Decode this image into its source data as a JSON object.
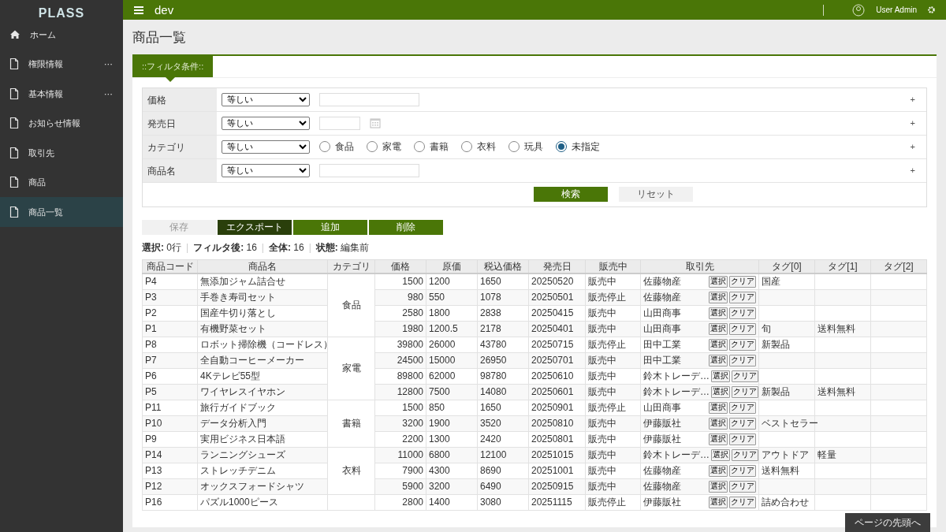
{
  "header": {
    "logo": "PLASS",
    "title": "dev",
    "user": "User Admin"
  },
  "sidebar": {
    "items": [
      {
        "label": "ホーム",
        "kind": "home",
        "selected": false
      },
      {
        "label": "権限情報",
        "kind": "page",
        "more": "⋯",
        "selected": false
      },
      {
        "label": "基本情報",
        "kind": "page",
        "more": "⋯",
        "selected": false
      },
      {
        "label": "お知らせ情報",
        "kind": "page",
        "selected": false
      },
      {
        "label": "取引先",
        "kind": "page",
        "selected": false
      },
      {
        "label": "商品",
        "kind": "page",
        "selected": false
      },
      {
        "label": "商品一覧",
        "kind": "page",
        "selected": true
      }
    ]
  },
  "page_title": "商品一覧",
  "filter": {
    "tab": "::フィルタ条件::",
    "rows": [
      {
        "label": "価格",
        "operator": "等しい",
        "kind": "text",
        "expand": "+"
      },
      {
        "label": "発売日",
        "operator": "等しい",
        "kind": "date",
        "expand": "+"
      },
      {
        "label": "カテゴリ",
        "operator": "等しい",
        "kind": "radio",
        "expand": "+",
        "options": [
          {
            "label": "食品",
            "selected": false
          },
          {
            "label": "家電",
            "selected": false
          },
          {
            "label": "書籍",
            "selected": false
          },
          {
            "label": "衣料",
            "selected": false
          },
          {
            "label": "玩具",
            "selected": false
          },
          {
            "label": "未指定",
            "selected": true
          }
        ]
      },
      {
        "label": "商品名",
        "operator": "等しい",
        "kind": "text",
        "expand": "+"
      }
    ],
    "buttons": [
      {
        "label": "検索",
        "kind": "primary"
      },
      {
        "label": "リセット",
        "kind": "light"
      }
    ]
  },
  "actions": [
    {
      "label": "保存",
      "kind": "light",
      "disabled": true
    },
    {
      "label": "エクスポート",
      "kind": "dark",
      "disabled": false
    },
    {
      "label": "追加",
      "kind": "primary",
      "disabled": false
    },
    {
      "label": "削除",
      "kind": "primary",
      "disabled": false
    }
  ],
  "status": [
    {
      "label": "選択:",
      "value": "0行"
    },
    {
      "separator": "|",
      "label": "フィルタ後:",
      "value": "16"
    },
    {
      "separator": "|",
      "label": "全体:",
      "value": "16"
    },
    {
      "separator": "|",
      "label": "状態:",
      "value": "編集前"
    }
  ],
  "table": {
    "columns": [
      "商品コード",
      "商品名",
      "カテゴリ",
      "価格",
      "原価",
      "税込価格",
      "発売日",
      "販売中",
      "取引先",
      "タグ[0]",
      "タグ[1]",
      "タグ[2]"
    ],
    "groups": [
      {
        "category": "食品",
        "rows": [
          {
            "code": "P4",
            "name": "無添加ジャム詰合せ",
            "price": "1500",
            "cost": "1200",
            "tax_price": "1650",
            "release": "20250520",
            "sale": "販売中",
            "supplier": "佐藤物産",
            "buttons": [
              "選択",
              "クリア"
            ],
            "tags": [
              "国産"
            ]
          },
          {
            "code": "P3",
            "name": "手巻き寿司セット",
            "price": "980",
            "cost": "550",
            "tax_price": "1078",
            "release": "20250501",
            "sale": "販売停止",
            "supplier": "佐藤物産",
            "buttons": [
              "選択",
              "クリア"
            ],
            "tags": []
          },
          {
            "code": "P2",
            "name": "国産牛切り落とし",
            "price": "2580",
            "cost": "1800",
            "tax_price": "2838",
            "release": "20250415",
            "sale": "販売中",
            "supplier": "山田商事",
            "buttons": [
              "選択",
              "クリア"
            ],
            "tags": []
          },
          {
            "code": "P1",
            "name": "有機野菜セット",
            "price": "1980",
            "cost": "1200.5",
            "tax_price": "2178",
            "release": "20250401",
            "sale": "販売中",
            "supplier": "山田商事",
            "buttons": [
              "選択",
              "クリア"
            ],
            "tags": [
              "旬",
              "送料無料"
            ]
          }
        ]
      },
      {
        "category": "家電",
        "rows": [
          {
            "code": "P8",
            "name": "ロボット掃除機（コードレス）",
            "price": "39800",
            "cost": "26000",
            "tax_price": "43780",
            "release": "20250715",
            "sale": "販売停止",
            "supplier": "田中工業",
            "buttons": [
              "選択",
              "クリア"
            ],
            "tags": [
              "新製品"
            ]
          },
          {
            "code": "P7",
            "name": "全自動コーヒーメーカー",
            "price": "24500",
            "cost": "15000",
            "tax_price": "26950",
            "release": "20250701",
            "sale": "販売中",
            "supplier": "田中工業",
            "buttons": [
              "選択",
              "クリア"
            ],
            "tags": []
          },
          {
            "code": "P6",
            "name": "4Kテレビ55型",
            "price": "89800",
            "cost": "62000",
            "tax_price": "98780",
            "release": "20250610",
            "sale": "販売中",
            "supplier": "鈴木トレーデ…",
            "buttons": [
              "選択",
              "クリア"
            ],
            "tags": []
          },
          {
            "code": "P5",
            "name": "ワイヤレスイヤホン",
            "price": "12800",
            "cost": "7500",
            "tax_price": "14080",
            "release": "20250601",
            "sale": "販売中",
            "supplier": "鈴木トレーデ…",
            "buttons": [
              "選択",
              "クリア"
            ],
            "tags": [
              "新製品",
              "送料無料"
            ]
          }
        ]
      },
      {
        "category": "書籍",
        "rows": [
          {
            "code": "P11",
            "name": "旅行ガイドブック",
            "price": "1500",
            "cost": "850",
            "tax_price": "1650",
            "release": "20250901",
            "sale": "販売停止",
            "supplier": "山田商事",
            "buttons": [
              "選択",
              "クリア"
            ],
            "tags": []
          },
          {
            "code": "P10",
            "name": "データ分析入門",
            "price": "3200",
            "cost": "1900",
            "tax_price": "3520",
            "release": "20250810",
            "sale": "販売中",
            "supplier": "伊藤販社",
            "buttons": [
              "選択",
              "クリア"
            ],
            "tags": [
              "ベストセラー"
            ]
          },
          {
            "code": "P9",
            "name": "実用ビジネス日本語",
            "price": "2200",
            "cost": "1300",
            "tax_price": "2420",
            "release": "20250801",
            "sale": "販売中",
            "supplier": "伊藤販社",
            "buttons": [
              "選択",
              "クリア"
            ],
            "tags": []
          }
        ]
      },
      {
        "category": "衣料",
        "rows": [
          {
            "code": "P14",
            "name": "ランニングシューズ",
            "price": "11000",
            "cost": "6800",
            "tax_price": "12100",
            "release": "20251015",
            "sale": "販売中",
            "supplier": "鈴木トレーデ…",
            "buttons": [
              "選択",
              "クリア"
            ],
            "tags": [
              "アウトドア",
              "軽量"
            ]
          },
          {
            "code": "P13",
            "name": "ストレッチデニム",
            "price": "7900",
            "cost": "4300",
            "tax_price": "8690",
            "release": "20251001",
            "sale": "販売中",
            "supplier": "佐藤物産",
            "buttons": [
              "選択",
              "クリア"
            ],
            "tags": [
              "送料無料"
            ]
          },
          {
            "code": "P12",
            "name": "オックスフォードシャツ",
            "price": "5900",
            "cost": "3200",
            "tax_price": "6490",
            "release": "20250915",
            "sale": "販売中",
            "supplier": "佐藤物産",
            "buttons": [
              "選択",
              "クリア"
            ],
            "tags": []
          }
        ]
      },
      {
        "rows": [
          {
            "code": "P16",
            "name": "パズル1000ピース",
            "price": "2800",
            "cost": "1400",
            "tax_price": "3080",
            "release": "20251115",
            "sale": "販売停止",
            "supplier": "伊藤販社",
            "buttons": [
              "選択",
              "クリア"
            ],
            "tags": [
              "詰め合わせ"
            ]
          }
        ]
      }
    ]
  },
  "back_to_top": "ページの先頭へ"
}
